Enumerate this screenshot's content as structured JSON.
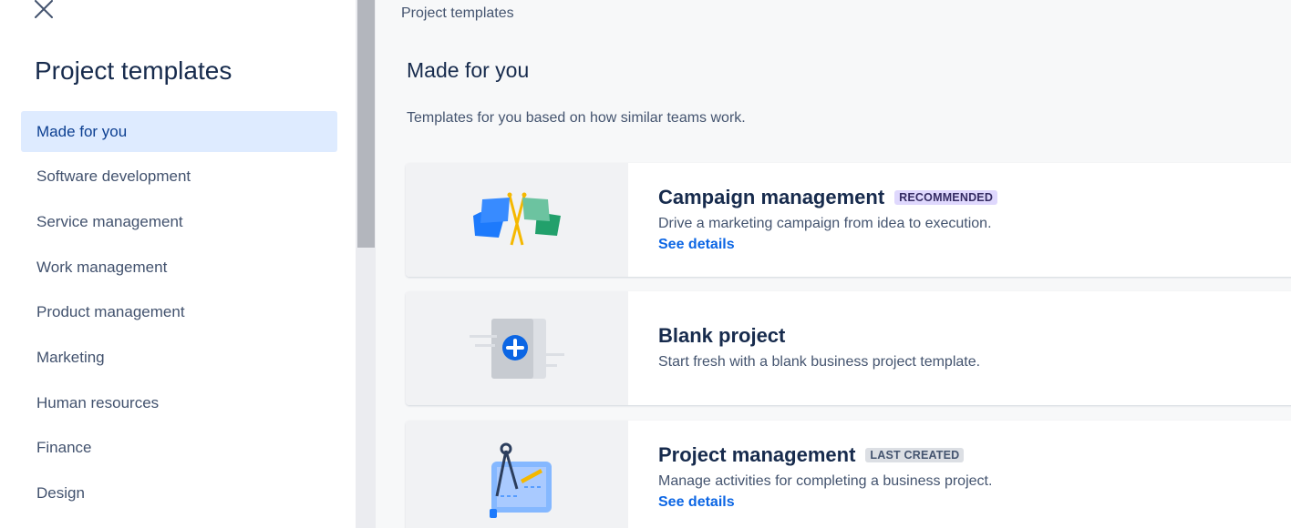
{
  "sidebar": {
    "close_label": "×",
    "title": "Project templates",
    "items": [
      {
        "label": "Made for you",
        "active": true
      },
      {
        "label": "Software development"
      },
      {
        "label": "Service management"
      },
      {
        "label": "Work management"
      },
      {
        "label": "Product management"
      },
      {
        "label": "Marketing"
      },
      {
        "label": "Human resources"
      },
      {
        "label": "Finance"
      },
      {
        "label": "Design"
      }
    ]
  },
  "main": {
    "breadcrumb": "Project templates",
    "title": "Made for you",
    "description": "Templates for you based on how similar teams work.",
    "cards": [
      {
        "icon": "crossed-flags-illustration",
        "title": "Campaign management",
        "badge": "RECOMMENDED",
        "description": "Drive a marketing campaign from idea to execution.",
        "link": "See details"
      },
      {
        "icon": "blank-project-plus-illustration",
        "title": "Blank project",
        "description": "Start fresh with a blank business project template."
      },
      {
        "icon": "blueprint-compass-illustration",
        "title": "Project management",
        "badge": "LAST CREATED",
        "description": "Manage activities for completing a business project.",
        "link": "See details"
      }
    ]
  },
  "colors": {
    "accent": "#0c66e4",
    "active_nav_bg": "#deebff",
    "badge_recommended_bg": "#dfd8fd",
    "badge_last_created_bg": "#dcdfe4"
  }
}
